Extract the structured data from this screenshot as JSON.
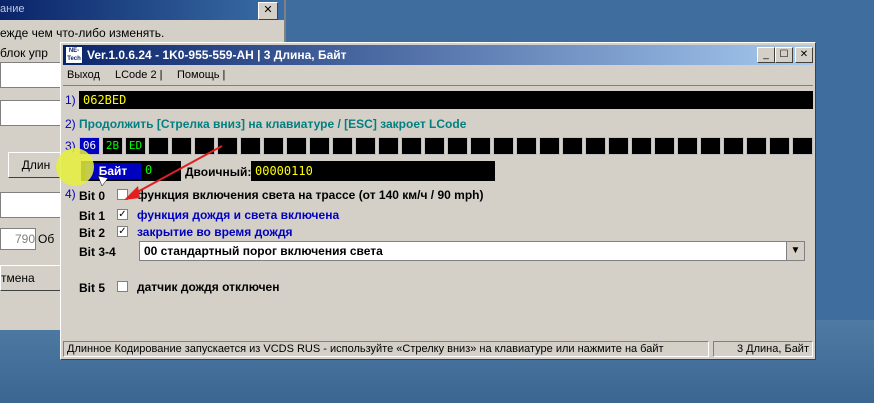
{
  "bg_window": {
    "title": "ание",
    "close": "✕",
    "line1": "ежде чем что-либо изменять.",
    "line2": "блок упр",
    "button1": "Длин",
    "field_value": "790",
    "field_label": "Об",
    "button2": "тмена"
  },
  "window": {
    "logo": "NE-Tech",
    "title": "Ver.1.0.6.24 -   1K0-955-559-AH | 3 Длина, Байт",
    "minimize": "_",
    "maximize": "☐",
    "close": "✕"
  },
  "menu": {
    "exit": "Выход",
    "lcode": "LCode 2 |",
    "help": "Помощь |"
  },
  "step1": {
    "num": "1)",
    "value": "062BED"
  },
  "step2": {
    "num": "2)",
    "text": "Продолжить [Стрелка вниз] на клавиатуре / [ESC] закроет LCode"
  },
  "step3": {
    "num": "3)",
    "cells": [
      "06",
      "2B",
      "ED",
      "",
      "",
      "",
      "",
      "",
      "",
      "",
      "",
      "",
      "",
      "",
      "",
      "",
      "",
      "",
      "",
      "",
      "",
      "",
      "",
      "",
      "",
      "",
      "",
      "",
      "",
      "",
      "",
      ""
    ]
  },
  "byte": {
    "label": "Байт",
    "value": "0",
    "binary_label": "Двоичный:",
    "binary_value": "00000110"
  },
  "step4": {
    "num": "4)"
  },
  "bits": [
    {
      "label": "Bit 0",
      "checked": "",
      "text": "функция включения света на трассе (от 140 км/ч / 90 mph)"
    },
    {
      "label": "Bit 1",
      "checked": "✓",
      "text": "функция дождя и света включена"
    },
    {
      "label": "Bit 2",
      "checked": "✓",
      "text": "закрытие во время дождя"
    },
    {
      "label": "Bit 3-4",
      "value": "00 стандартный порог включения света",
      "arrow": "▼"
    },
    {
      "label": "Bit 5",
      "checked": "",
      "text": "датчик дождя отключен"
    }
  ],
  "status": {
    "main": "Длинное Кодирование  запускается из VCDS RUS - используйте «Стрелку вниз» на клавиатуре или нажмите на байт",
    "right": "3 Длина, Байт"
  },
  "colors": {
    "title_start": "#0a246a",
    "title_end": "#a6caf0",
    "highlight_blue": "#0000c0",
    "teal": "#008080",
    "yellow_text": "#ffff00",
    "green_text": "#00ff00",
    "arrow_red": "#e02020"
  }
}
